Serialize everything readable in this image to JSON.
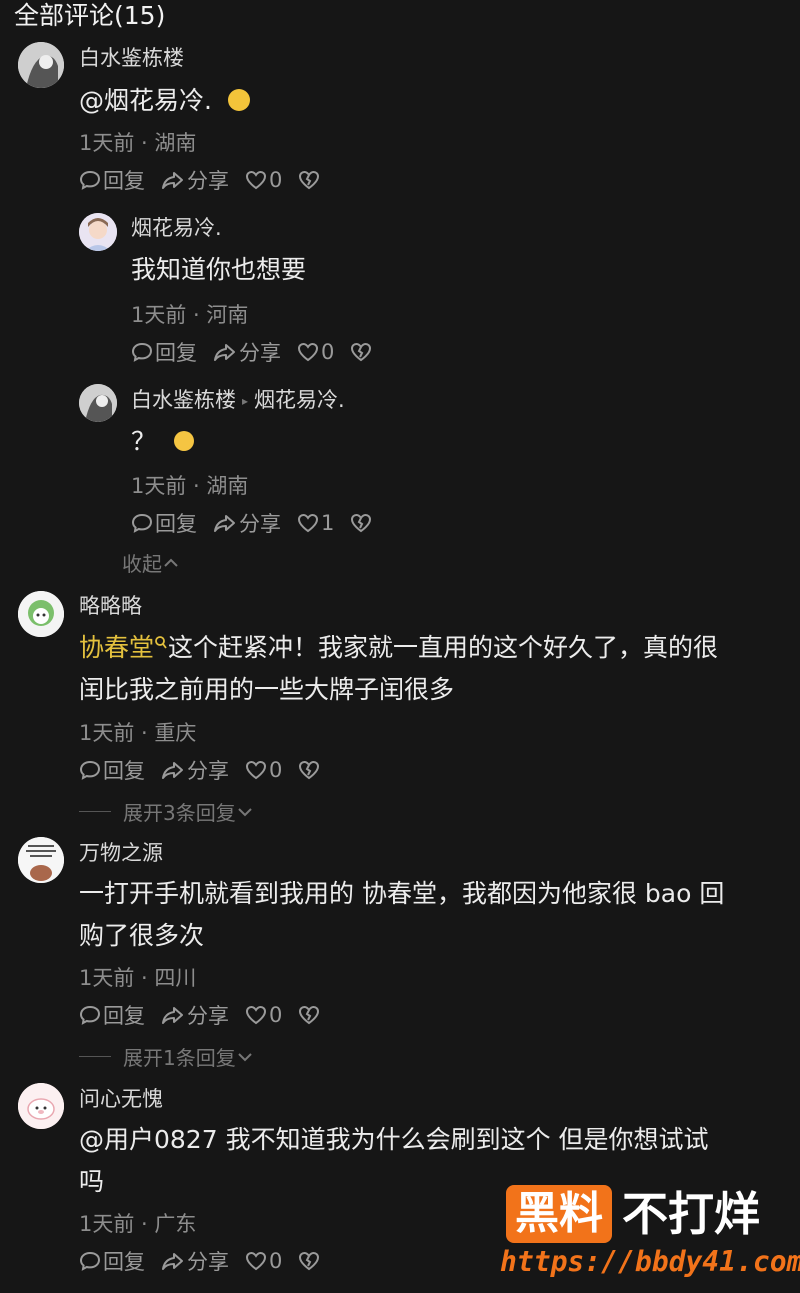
{
  "header": {
    "title": "全部评论(15)"
  },
  "icons": {
    "reply": "comment-bubble-icon",
    "share": "share-arrow-icon",
    "like": "heart-icon",
    "dislike": "broken-heart-icon"
  },
  "comments": [
    {
      "user": "白水鉴栋楼",
      "text": "@烟花易冷.",
      "emoji": "flushed-emoji-icon",
      "time": "1天前",
      "location": "湖南",
      "reply": "回复",
      "share": "分享",
      "likes": "0",
      "replies": [
        {
          "user": "烟花易冷.",
          "text": "我知道你也想要",
          "time": "1天前",
          "location": "河南",
          "reply": "回复",
          "share": "分享",
          "likes": "0"
        },
        {
          "user": "白水鉴栋楼",
          "reply_to": "烟花易冷.",
          "text": "？",
          "emoji": "smirk-emoji-icon",
          "time": "1天前",
          "location": "湖南",
          "reply": "回复",
          "share": "分享",
          "likes": "1"
        }
      ],
      "collapse": "收起"
    },
    {
      "user": "略略略",
      "link": "协春堂",
      "text_line1": "这个赶紧冲！我家就一直用的这个好久了，真的很",
      "text_line2": "闰比我之前用的一些大牌子闰很多",
      "time": "1天前",
      "location": "重庆",
      "reply": "回复",
      "share": "分享",
      "likes": "0",
      "expand": "展开3条回复"
    },
    {
      "user": "万物之源",
      "text_line1": "一打开手机就看到我用的 协春堂，我都因为他家很 bao 回",
      "text_line2": "购了很多次",
      "time": "1天前",
      "location": "四川",
      "reply": "回复",
      "share": "分享",
      "likes": "0",
      "expand": "展开1条回复"
    },
    {
      "user": "问心无愧",
      "text_line1": "@用户0827 我不知道我为什么会刷到这个 但是你想试试",
      "text_line2": "吗",
      "time": "1天前",
      "location": "广东",
      "reply": "回复",
      "share": "分享",
      "likes": "0"
    }
  ],
  "watermark": {
    "badge": "黑料",
    "text": "不打烊",
    "url": "https://bbdy41.com"
  },
  "colors": {
    "background": "#161616",
    "link": "#e4c13e",
    "watermark": "#f2731a"
  }
}
